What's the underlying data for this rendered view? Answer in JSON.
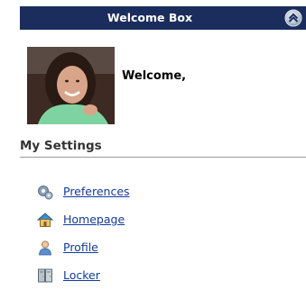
{
  "header": {
    "title": "Welcome Box"
  },
  "user": {
    "welcome_text": "Welcome,"
  },
  "settings": {
    "title": "My Settings",
    "items": [
      {
        "label": "Preferences",
        "icon": "gears-icon"
      },
      {
        "label": "Homepage",
        "icon": "house-icon"
      },
      {
        "label": "Profile",
        "icon": "user-icon"
      },
      {
        "label": "Locker",
        "icon": "locker-icon"
      }
    ]
  },
  "colors": {
    "header_bg": "#1b2d5c",
    "link": "#123b9a",
    "divider": "#9a9a9a"
  }
}
